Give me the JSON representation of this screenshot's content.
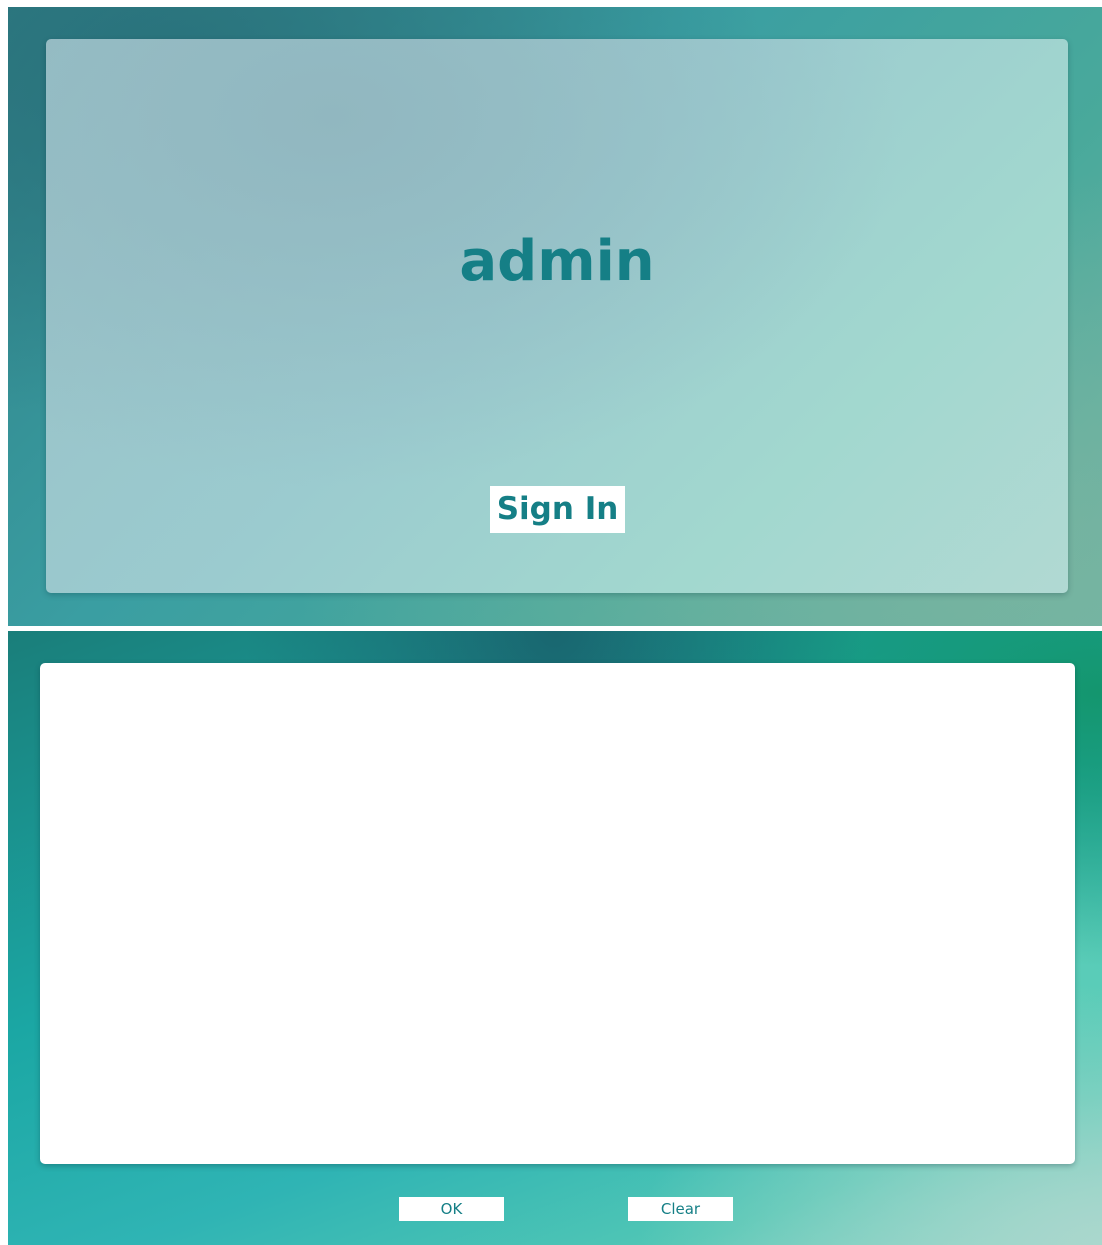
{
  "signin_screen": {
    "user_name": "admin",
    "sign_in_label": "Sign In"
  },
  "signature_screen": {
    "ok_label": "OK",
    "clear_label": "Clear"
  },
  "colors": {
    "accent_text": "#157f86",
    "button_background": "#ffffff"
  }
}
